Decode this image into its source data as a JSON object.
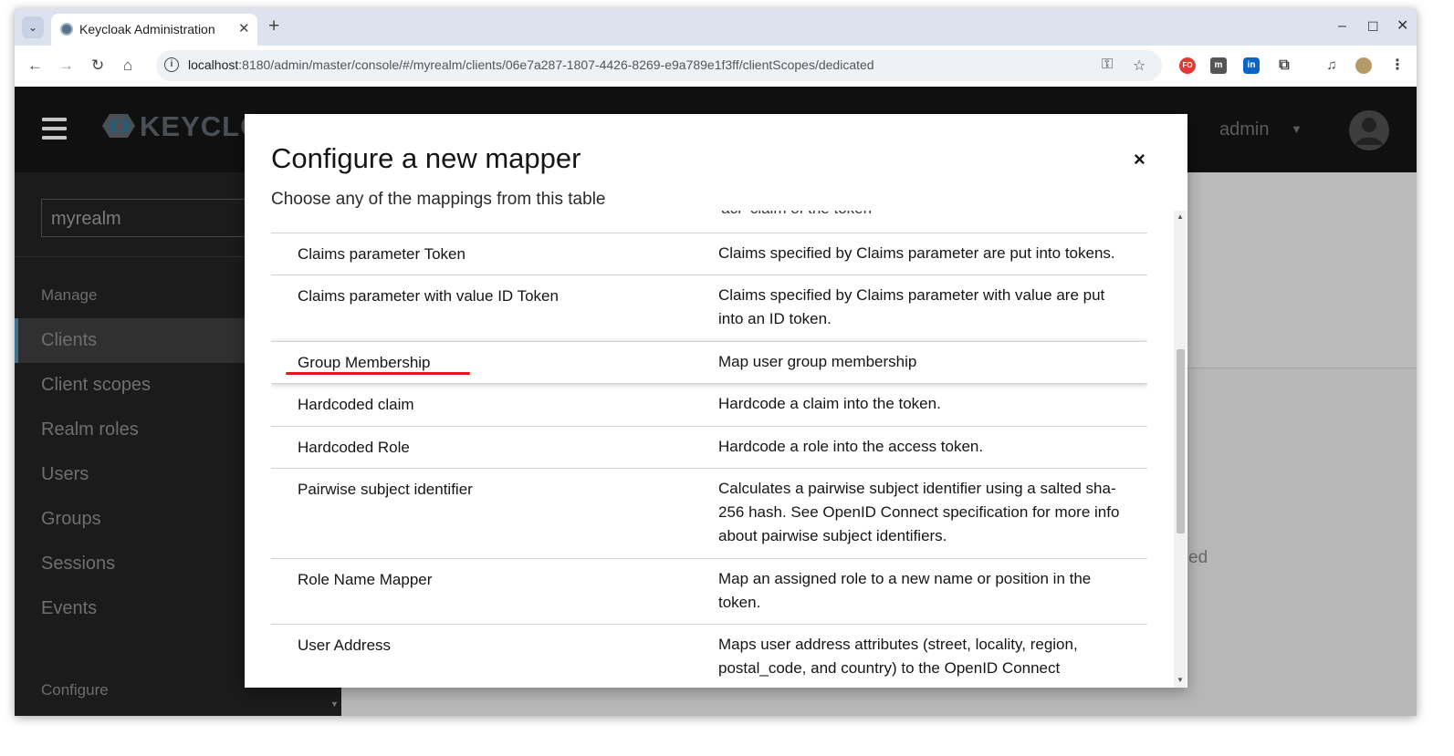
{
  "browser": {
    "tab_title": "Keycloak Administration",
    "tab_close": "✕",
    "new_tab": "+",
    "tab_list": "⌄",
    "window_controls": {
      "minimize": "–",
      "maximize": "☐",
      "close": "✕"
    },
    "nav": {
      "back": "←",
      "forward": "→",
      "reload": "↻",
      "home": "⌂"
    },
    "url_host": "localhost",
    "url_rest": ":8180/admin/master/console/#/myrealm/clients/06e7a287-1807-4426-8269-e9a789e1f3ff/clientScopes/dedicated",
    "omni_icons": {
      "password": "⚿",
      "bookmark": "☆"
    },
    "extensions": [
      "FO",
      "m",
      "in",
      "puzzle",
      "media",
      "profile",
      "menu"
    ]
  },
  "app": {
    "logo_text": "KEYCLOA",
    "user_name": "admin",
    "user_menu_caret": "▼",
    "realm_selector": "myrealm",
    "sidebar": {
      "manage_heading": "Manage",
      "items": [
        "Clients",
        "Client scopes",
        "Realm roles",
        "Users",
        "Groups",
        "Sessions",
        "Events"
      ],
      "active_item": "Clients",
      "configure_heading": "Configure"
    },
    "background_text_fragment": "ed"
  },
  "modal": {
    "title": "Configure a new mapper",
    "close": "×",
    "subtitle": "Choose any of the mappings from this table",
    "partial_row_desc": "'acr' claim of the token",
    "rows": [
      {
        "name": "Claims parameter Token",
        "desc": "Claims specified by Claims parameter are put into tokens."
      },
      {
        "name": "Claims parameter with value ID Token",
        "desc": "Claims specified by Claims parameter with value are put into an ID token."
      },
      {
        "name": "Group Membership",
        "desc": "Map user group membership"
      },
      {
        "name": "Hardcoded claim",
        "desc": "Hardcode a claim into the token."
      },
      {
        "name": "Hardcoded Role",
        "desc": "Hardcode a role into the access token."
      },
      {
        "name": "Pairwise subject identifier",
        "desc": "Calculates a pairwise subject identifier using a salted sha-256 hash. See OpenID Connect specification for more info about pairwise subject identifiers."
      },
      {
        "name": "Role Name Mapper",
        "desc": "Map an assigned role to a new name or position in the token."
      },
      {
        "name": "User Address",
        "desc": "Maps user address attributes (street, locality, region, postal_code, and country) to the OpenID Connect"
      }
    ],
    "highlighted_row": "Group Membership",
    "annotation_color": "#e0191f"
  }
}
